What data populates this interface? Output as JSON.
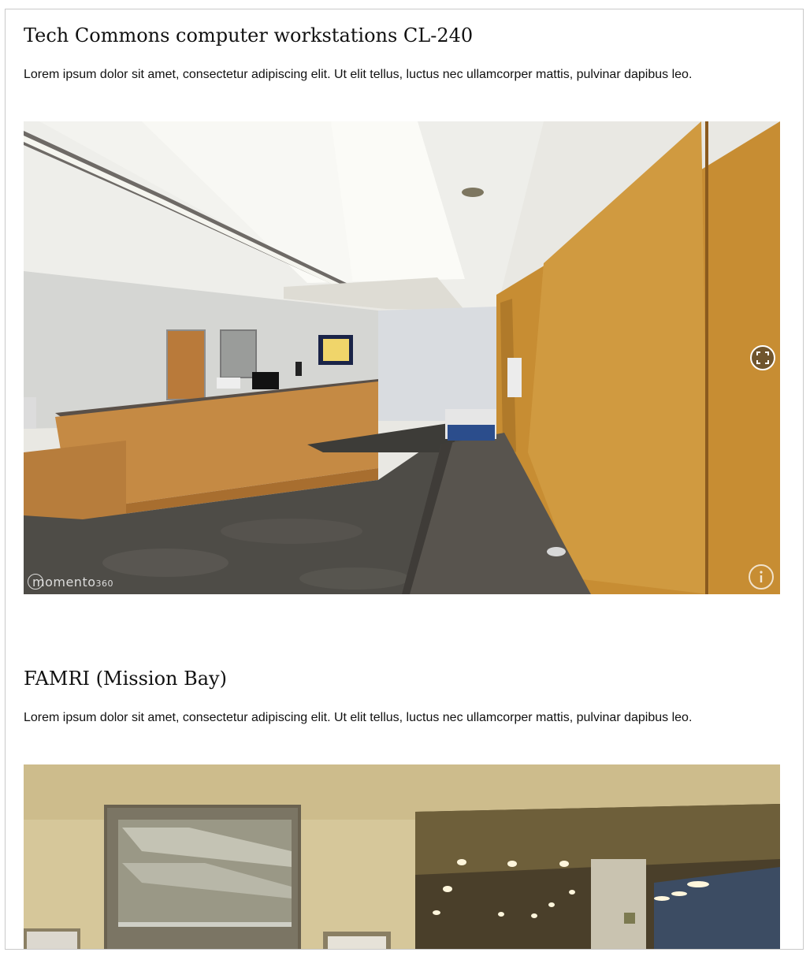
{
  "sections": [
    {
      "title": "Tech Commons computer workstations CL-240",
      "description": "Lorem ipsum dolor sit amet, consectetur adipiscing elit. Ut elit tellus, luctus nec ullamcorper mattis, pulvinar dapibus leo.",
      "viewer": {
        "brand_main": "momento",
        "brand_suffix": "360",
        "fullscreen_icon": "fullscreen-icon",
        "info_icon": "info-icon"
      }
    },
    {
      "title": "FAMRI (Mission Bay)",
      "description": "Lorem ipsum dolor sit amet, consectetur adipiscing elit. Ut elit tellus, luctus nec ullamcorper mattis, pulvinar dapibus leo."
    }
  ],
  "colors": {
    "wood_wall": "#c98f34",
    "carpet": "#4c4a45",
    "ceiling": "#ecebe6",
    "wall_beige": "#d8c99c"
  }
}
